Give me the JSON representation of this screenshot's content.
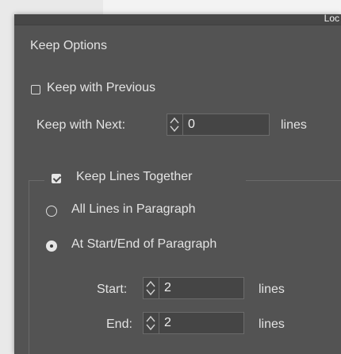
{
  "top_right_text": "Loc",
  "section_title": "Keep Options",
  "keep_with_previous": {
    "label": "Keep with Previous",
    "checked": false
  },
  "keep_with_next": {
    "label": "Keep with Next:",
    "value": "0",
    "unit": "lines"
  },
  "keep_lines_together": {
    "label": "Keep Lines Together",
    "checked": true,
    "options": [
      {
        "label": "All Lines in Paragraph",
        "selected": false
      },
      {
        "label": "At Start/End of Paragraph",
        "selected": true
      }
    ],
    "start": {
      "label": "Start:",
      "value": "2",
      "unit": "lines"
    },
    "end": {
      "label": "End:",
      "value": "2",
      "unit": "lines"
    }
  }
}
